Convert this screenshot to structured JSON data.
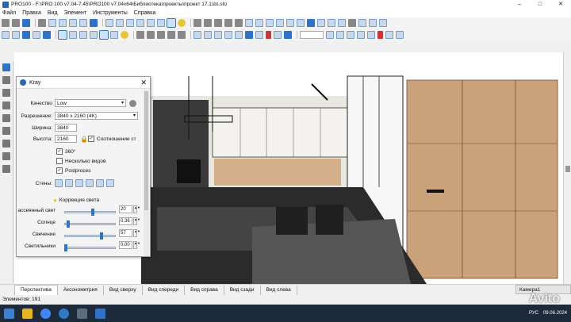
{
  "window": {
    "title": "PRO100 - F:\\PRO 100 v7.04-7.45\\PRO100 v7.04x64\\Библиотека\\проекты\\проект 17.1sto.sto"
  },
  "menu": [
    "Файл",
    "Правка",
    "Вид",
    "Элемент",
    "Инструменты",
    "Справка"
  ],
  "dialog": {
    "title": "Kray",
    "quality_label": "Качество",
    "quality_value": "Low",
    "resolution_label": "Разрешение:",
    "resolution_value": "3840 x 2160 (4K)",
    "width_label": "Ширина:",
    "width_value": "3840",
    "height_label": "Высота:",
    "height_value": "2160",
    "aspect_label": "Соотношение ст",
    "cb_360": "360°",
    "cb_multi": "Несколько видов",
    "cb_post": "Postproces",
    "walls_label": "Стены:",
    "light_corr_label": "Коррекция света",
    "ambient_label": "ассеянный свет",
    "ambient_value": "20",
    "sun_label": "Солнце",
    "sun_value": "0,36",
    "glow_label": "Свечение",
    "glow_value": "57",
    "lamps_label": "Светильники",
    "lamps_value": "0,00"
  },
  "view_tabs": [
    "Перспектива",
    "Аксонометрия",
    "Вид сверху",
    "Вид спереди",
    "Вид справа",
    "Вид сзади",
    "Вид слева"
  ],
  "camera_tab": "Камера1",
  "status": {
    "elements": "Элементов: 191"
  },
  "tray": {
    "lang": "РУС",
    "date": "09.06.2024"
  },
  "watermark": "Avito",
  "colors": {
    "accent": "#2f73c9",
    "taskbar": "#1d2a3a",
    "wood": "#caa27a"
  }
}
